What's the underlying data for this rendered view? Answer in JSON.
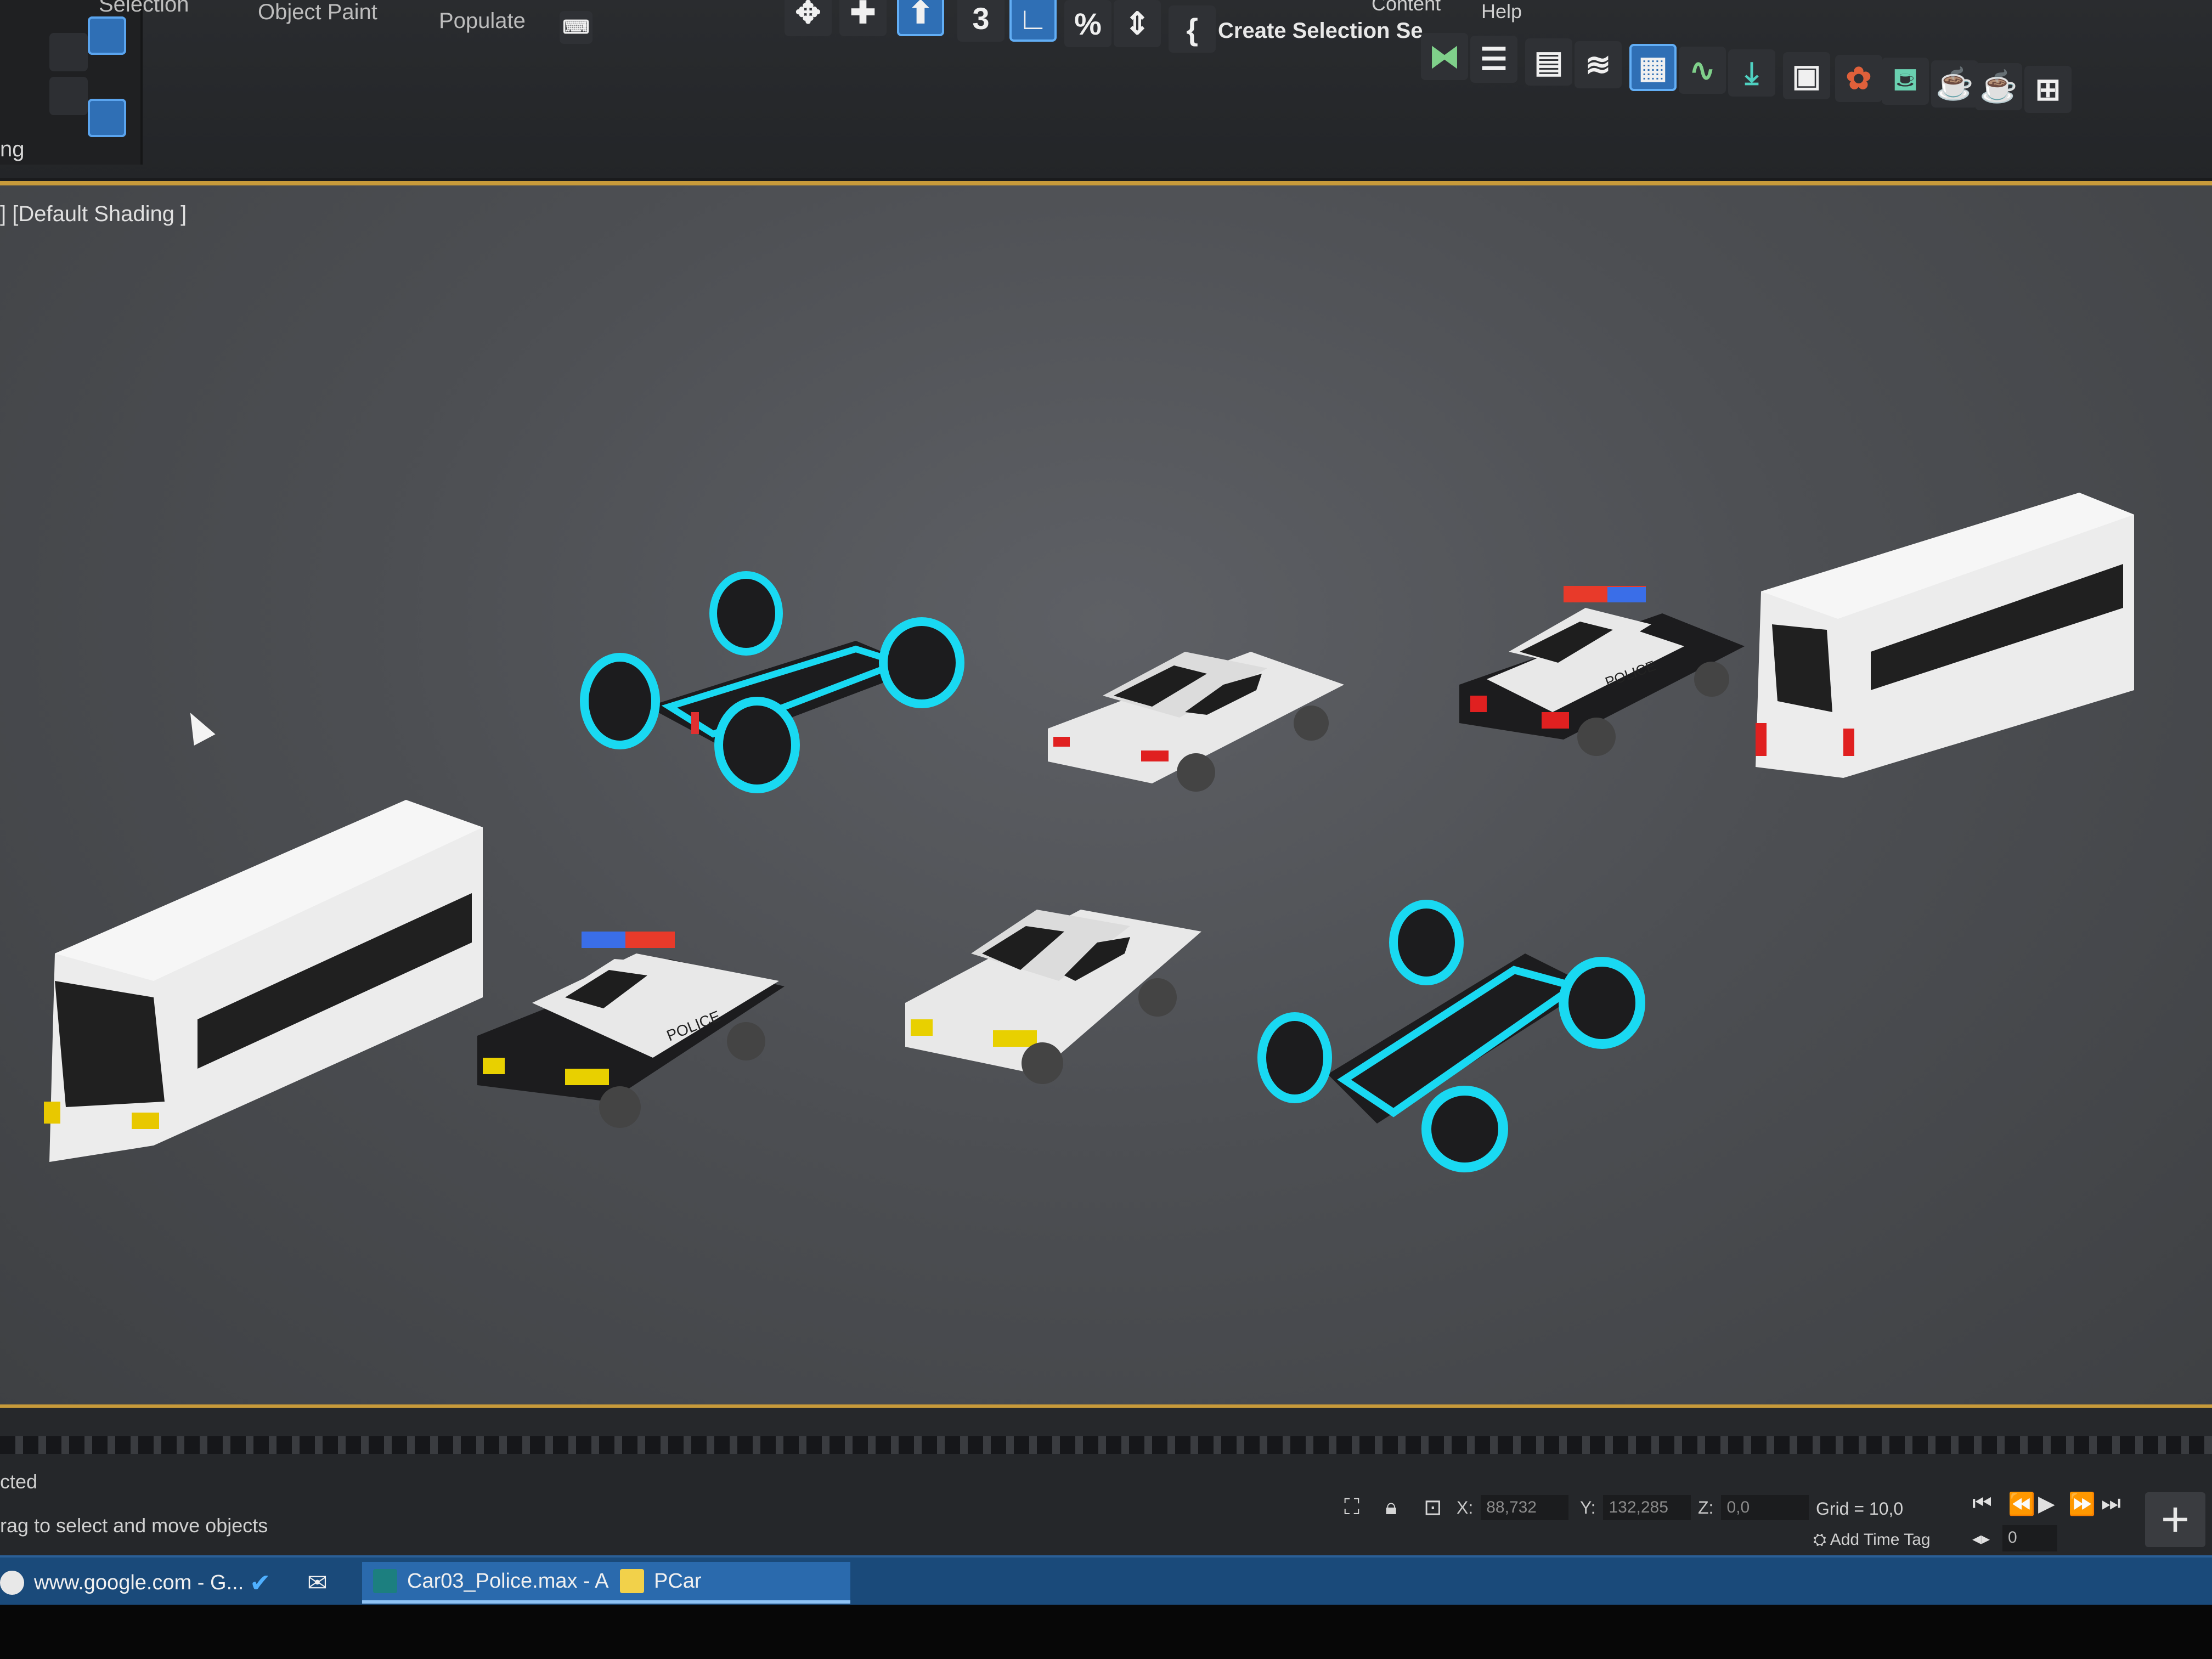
{
  "toolbar": {
    "commands": [
      "Selection",
      "Object Paint",
      "Populate"
    ],
    "menus": [
      "Content",
      "Help"
    ],
    "selection_set": "Create Selection Se",
    "tool_icons": [
      "select-move-icon",
      "snap-3-icon",
      "angle-snap-icon",
      "percent-snap-icon",
      "spinner-snap-icon",
      "named-selection-icon",
      "mirror-icon",
      "align-icon",
      "scene-explorer-icon",
      "layer-explorer-icon",
      "ribbon-icon",
      "curve-editor-icon",
      "schematic-icon",
      "material-editor-icon",
      "render-setup-icon",
      "render-frame-icon",
      "render-icon",
      "render-iterative-icon",
      "render-cloud-icon"
    ],
    "left_panel_label": "ng"
  },
  "viewport": {
    "label": "] [Default Shading ]",
    "vehicles": [
      {
        "name": "futuristic-racer",
        "body": "#1c1c1e",
        "accent": "#19d9f2"
      },
      {
        "name": "white-sedan",
        "body": "#ececec",
        "accent": "#e02020"
      },
      {
        "name": "police-car",
        "body": "#1c1c1e",
        "accent": "#e8e8e8",
        "decal": "POLICE"
      },
      {
        "name": "white-bus",
        "body": "#eeeeee",
        "accent": "#202020"
      },
      {
        "name": "white-bus",
        "body": "#eeeeee",
        "accent": "#202020"
      },
      {
        "name": "police-car",
        "body": "#1c1c1e",
        "accent": "#e8e8e8",
        "decal": "POLICE"
      },
      {
        "name": "white-sedan",
        "body": "#ececec",
        "accent": "#e8d000"
      },
      {
        "name": "futuristic-racer",
        "body": "#1c1c1e",
        "accent": "#19d9f2"
      }
    ]
  },
  "status": {
    "selection_info": "cted",
    "prompt": "rag to select and move objects",
    "x_label": "X:",
    "x_value": "88,732",
    "y_label": "Y:",
    "y_value": "132,285",
    "z_label": "Z:",
    "z_value": "0,0",
    "grid": "Grid = 10,0",
    "add_time_tag": "Add Time Tag",
    "frame": "0"
  },
  "taskbar": {
    "items": [
      {
        "label": "www.google.com - G..."
      },
      {
        "label": ""
      },
      {
        "label": ""
      },
      {
        "label": "Car03_Police.max - A..."
      },
      {
        "label": "PCar"
      }
    ]
  },
  "colors": {
    "accent_gold": "#c79a3a",
    "selection_blue": "#2f6fb5",
    "taskbar_blue": "#1a4a7a"
  }
}
